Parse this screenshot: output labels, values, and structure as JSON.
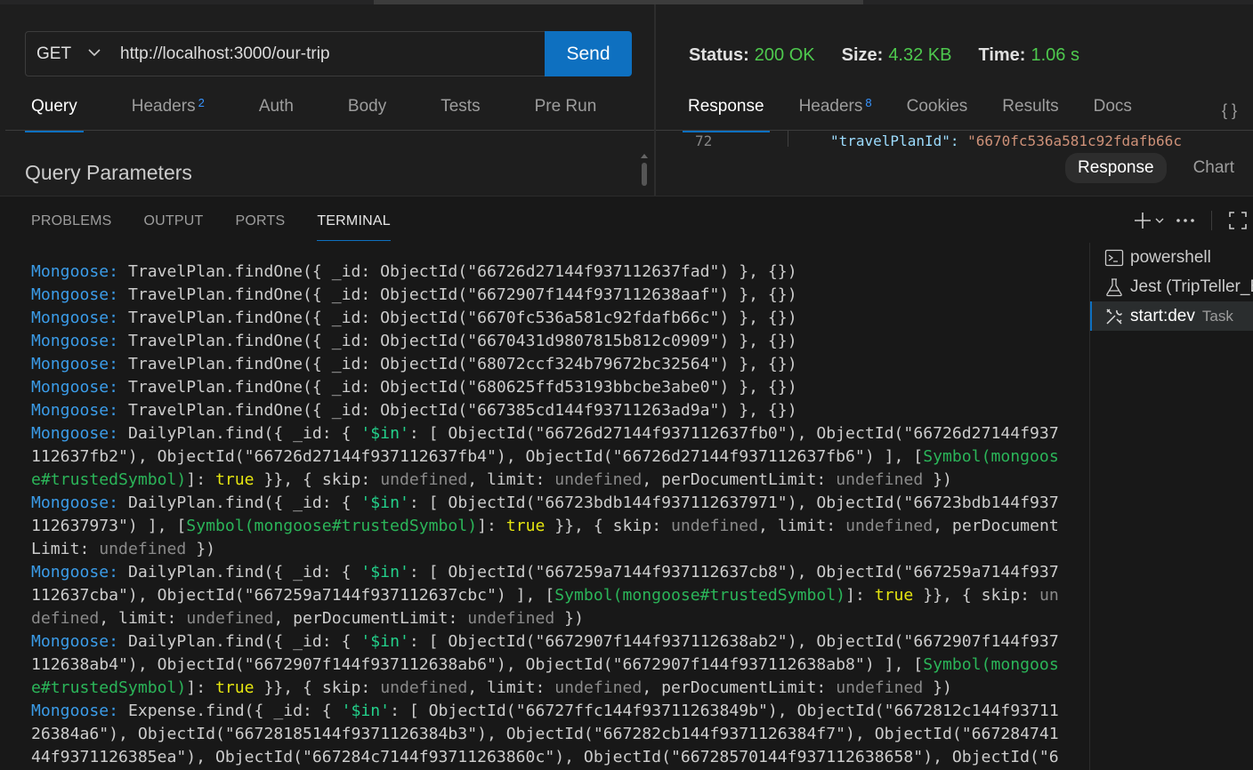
{
  "request": {
    "method": "GET",
    "url": "http://localhost:3000/our-trip",
    "send_label": "Send",
    "tabs": [
      {
        "label": "Query",
        "badge": ""
      },
      {
        "label": "Headers",
        "badge": "2"
      },
      {
        "label": "Auth",
        "badge": ""
      },
      {
        "label": "Body",
        "badge": ""
      },
      {
        "label": "Tests",
        "badge": ""
      },
      {
        "label": "Pre Run",
        "badge": ""
      }
    ],
    "query_title": "Query Parameters"
  },
  "response": {
    "status_label": "Status:",
    "status_value": "200 OK",
    "size_label": "Size:",
    "size_value": "4.32 KB",
    "time_label": "Time:",
    "time_value": "1.06 s",
    "tabs": [
      {
        "label": "Response",
        "badge": ""
      },
      {
        "label": "Headers",
        "badge": "8"
      },
      {
        "label": "Cookies",
        "badge": ""
      },
      {
        "label": "Results",
        "badge": ""
      },
      {
        "label": "Docs",
        "badge": ""
      }
    ],
    "braces_label": "{ }",
    "peek_line_number": "72",
    "peek_key": "\"travelPlanId\": ",
    "peek_value": "\"6670fc536a581c92fdafb66c",
    "view_options": [
      "Response",
      "Chart"
    ]
  },
  "panel": {
    "tabs": [
      "PROBLEMS",
      "OUTPUT",
      "PORTS",
      "TERMINAL"
    ],
    "active_tab": "TERMINAL",
    "terminals": [
      {
        "label": "powershell",
        "sub": "",
        "icon": "terminal-icon"
      },
      {
        "label": "Jest (TripTeller_B",
        "sub": "",
        "icon": "beaker-icon"
      },
      {
        "label": "start:dev",
        "sub": "Task",
        "icon": "tools-icon"
      }
    ]
  },
  "terminal_lines": [
    [
      [
        "b",
        "Mongoose:"
      ],
      [
        "t",
        " TravelPlan.findOne({ _id: ObjectId(\"66726d27144f937112637fad\") }, {})"
      ]
    ],
    [
      [
        "b",
        "Mongoose:"
      ],
      [
        "t",
        " TravelPlan.findOne({ _id: ObjectId(\"6672907f144f937112638aaf\") }, {})"
      ]
    ],
    [
      [
        "b",
        "Mongoose:"
      ],
      [
        "t",
        " TravelPlan.findOne({ _id: ObjectId(\"6670fc536a581c92fdafb66c\") }, {})"
      ]
    ],
    [
      [
        "b",
        "Mongoose:"
      ],
      [
        "t",
        " TravelPlan.findOne({ _id: ObjectId(\"6670431d9807815b812c0909\") }, {})"
      ]
    ],
    [
      [
        "b",
        "Mongoose:"
      ],
      [
        "t",
        " TravelPlan.findOne({ _id: ObjectId(\"68072ccf324b79672bc32564\") }, {})"
      ]
    ],
    [
      [
        "b",
        "Mongoose:"
      ],
      [
        "t",
        " TravelPlan.findOne({ _id: ObjectId(\"680625ffd53193bbcbe3abe0\") }, {})"
      ]
    ],
    [
      [
        "b",
        "Mongoose:"
      ],
      [
        "t",
        " TravelPlan.findOne({ _id: ObjectId(\"667385cd144f93711263ad9a\") }, {})"
      ]
    ],
    [
      [
        "b",
        "Mongoose:"
      ],
      [
        "t",
        " DailyPlan.find({ _id: { "
      ],
      [
        "q",
        "'$in'"
      ],
      [
        "t",
        ": [ ObjectId(\"66726d27144f937112637fb0\"), ObjectId(\"66726d27144f937"
      ]
    ],
    [
      [
        "t",
        "112637fb2\"), ObjectId(\"66726d27144f937112637fb4\"), ObjectId(\"66726d27144f937112637fb6\") ], ["
      ],
      [
        "g",
        "Symbol(mongoos"
      ]
    ],
    [
      [
        "g",
        "e#trustedSymbol)"
      ],
      [
        "t",
        "]: "
      ],
      [
        "y",
        "true"
      ],
      [
        "t",
        " }}, { skip: "
      ],
      [
        "d",
        "undefined"
      ],
      [
        "t",
        ", limit: "
      ],
      [
        "d",
        "undefined"
      ],
      [
        "t",
        ", perDocumentLimit: "
      ],
      [
        "d",
        "undefined"
      ],
      [
        "t",
        " })"
      ]
    ],
    [
      [
        "b",
        "Mongoose:"
      ],
      [
        "t",
        " DailyPlan.find({ _id: { "
      ],
      [
        "q",
        "'$in'"
      ],
      [
        "t",
        ": [ ObjectId(\"66723bdb144f937112637971\"), ObjectId(\"66723bdb144f937"
      ]
    ],
    [
      [
        "t",
        "112637973\") ], ["
      ],
      [
        "g",
        "Symbol(mongoose#trustedSymbol)"
      ],
      [
        "t",
        "]: "
      ],
      [
        "y",
        "true"
      ],
      [
        "t",
        " }}, { skip: "
      ],
      [
        "d",
        "undefined"
      ],
      [
        "t",
        ", limit: "
      ],
      [
        "d",
        "undefined"
      ],
      [
        "t",
        ", perDocument"
      ]
    ],
    [
      [
        "t",
        "Limit: "
      ],
      [
        "d",
        "undefined"
      ],
      [
        "t",
        " })"
      ]
    ],
    [
      [
        "b",
        "Mongoose:"
      ],
      [
        "t",
        " DailyPlan.find({ _id: { "
      ],
      [
        "q",
        "'$in'"
      ],
      [
        "t",
        ": [ ObjectId(\"667259a7144f937112637cb8\"), ObjectId(\"667259a7144f937"
      ]
    ],
    [
      [
        "t",
        "112637cba\"), ObjectId(\"667259a7144f937112637cbc\") ], ["
      ],
      [
        "g",
        "Symbol(mongoose#trustedSymbol)"
      ],
      [
        "t",
        "]: "
      ],
      [
        "y",
        "true"
      ],
      [
        "t",
        " }}, { skip: "
      ],
      [
        "d",
        "un"
      ]
    ],
    [
      [
        "d",
        "defined"
      ],
      [
        "t",
        ", limit: "
      ],
      [
        "d",
        "undefined"
      ],
      [
        "t",
        ", perDocumentLimit: "
      ],
      [
        "d",
        "undefined"
      ],
      [
        "t",
        " })"
      ]
    ],
    [
      [
        "b",
        "Mongoose:"
      ],
      [
        "t",
        " DailyPlan.find({ _id: { "
      ],
      [
        "q",
        "'$in'"
      ],
      [
        "t",
        ": [ ObjectId(\"6672907f144f937112638ab2\"), ObjectId(\"6672907f144f937"
      ]
    ],
    [
      [
        "t",
        "112638ab4\"), ObjectId(\"6672907f144f937112638ab6\"), ObjectId(\"6672907f144f937112638ab8\") ], ["
      ],
      [
        "g",
        "Symbol(mongoos"
      ]
    ],
    [
      [
        "g",
        "e#trustedSymbol)"
      ],
      [
        "t",
        "]: "
      ],
      [
        "y",
        "true"
      ],
      [
        "t",
        " }}, { skip: "
      ],
      [
        "d",
        "undefined"
      ],
      [
        "t",
        ", limit: "
      ],
      [
        "d",
        "undefined"
      ],
      [
        "t",
        ", perDocumentLimit: "
      ],
      [
        "d",
        "undefined"
      ],
      [
        "t",
        " })"
      ]
    ],
    [
      [
        "b",
        "Mongoose:"
      ],
      [
        "t",
        " Expense.find({ _id: { "
      ],
      [
        "q",
        "'$in'"
      ],
      [
        "t",
        ": [ ObjectId(\"66727ffc144f93711263849b\"), ObjectId(\"6672812c144f93711"
      ]
    ],
    [
      [
        "t",
        "26384a6\"), ObjectId(\"66728185144f9371126384b3\"), ObjectId(\"667282cb144f9371126384f7\"), ObjectId(\"667284741"
      ]
    ],
    [
      [
        "t",
        "44f9371126385ea\"), ObjectId(\"667284c7144f93711263860c\"), ObjectId(\"66728570144f937112638658\"), ObjectId(\"6"
      ]
    ]
  ],
  "colors": {
    "accent": "#0e70c0",
    "status_ok": "#4ec94e",
    "mongoose_label": "#3b9ce8",
    "symbol": "#2bb559",
    "keyword_true": "#e5e510",
    "undefined": "#8a8a8a"
  }
}
